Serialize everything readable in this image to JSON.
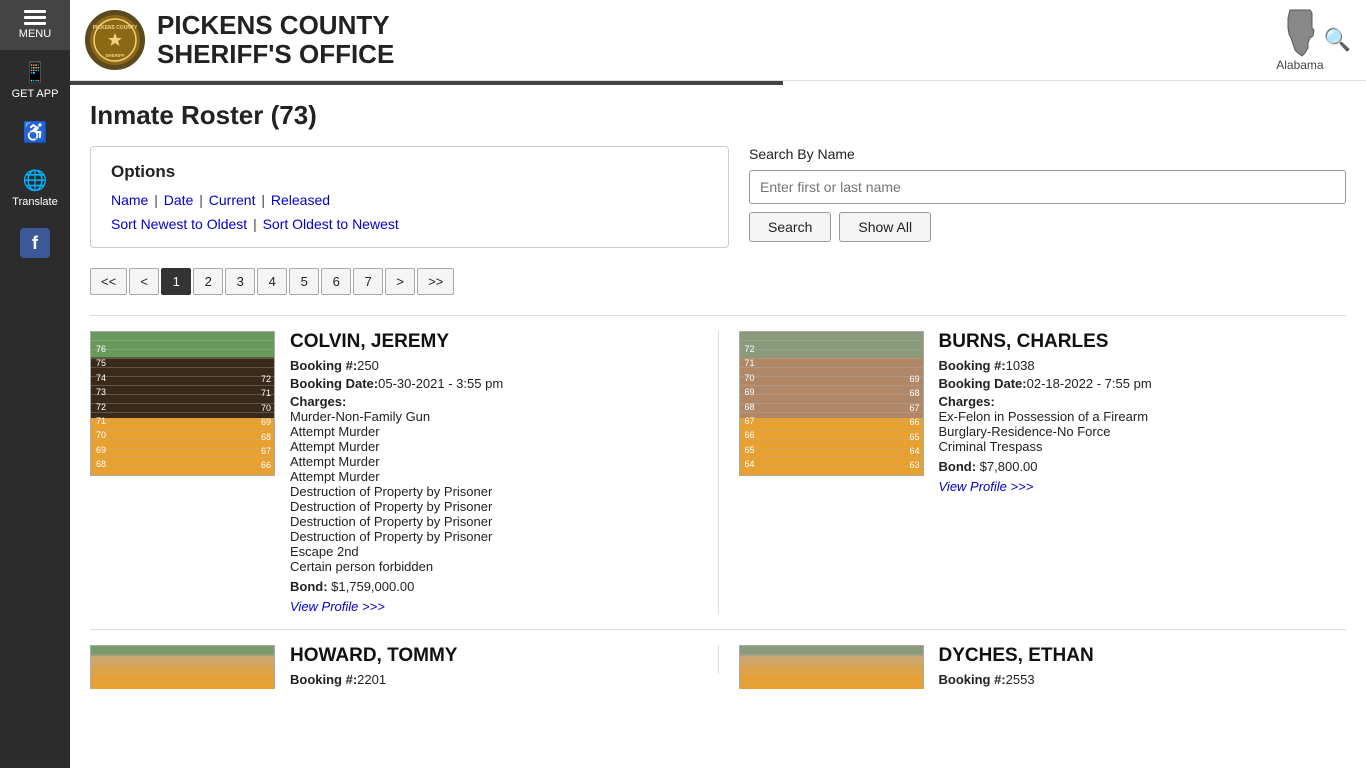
{
  "sidebar": {
    "items": [
      {
        "id": "menu",
        "label": "MENU",
        "icon": "≡"
      },
      {
        "id": "get-app",
        "label": "GET APP",
        "icon": "📱"
      },
      {
        "id": "accessibility",
        "label": "",
        "icon": "♿"
      },
      {
        "id": "translate",
        "label": "Translate",
        "icon": "🌐"
      },
      {
        "id": "facebook",
        "label": "",
        "icon": "f"
      }
    ]
  },
  "header": {
    "agency": "PICKENS COUNTY",
    "office": "SHERIFF'S OFFICE",
    "state": "Alabama"
  },
  "page": {
    "title": "Inmate Roster (73)"
  },
  "options": {
    "title": "Options",
    "links": {
      "name": "Name",
      "date": "Date",
      "current": "Current",
      "released": "Released"
    },
    "sort": {
      "newest": "Sort Newest to Oldest",
      "oldest": "Sort Oldest to Newest"
    }
  },
  "search": {
    "label": "Search By Name",
    "placeholder": "Enter first or last name",
    "search_btn": "Search",
    "show_all_btn": "Show All"
  },
  "pagination": {
    "first": "<<",
    "prev": "<",
    "pages": [
      "1",
      "2",
      "3",
      "4",
      "5",
      "6",
      "7"
    ],
    "next": ">",
    "last": ">>",
    "active": "1"
  },
  "inmates": [
    {
      "name": "COLVIN, JEREMY",
      "booking_num": "250",
      "booking_date": "05-30-2021 - 3:55 pm",
      "charges": [
        "Murder-Non-Family Gun",
        "Attempt Murder",
        "Attempt Murder",
        "Attempt Murder",
        "Attempt Murder",
        "Destruction of Property by Prisoner",
        "Destruction of Property by Prisoner",
        "Destruction of Property by Prisoner",
        "Destruction of Property by Prisoner",
        "Escape 2nd",
        "Certain person forbidden"
      ],
      "bond": "$1,759,000.00",
      "profile_link": "View Profile >>>"
    },
    {
      "name": "BURNS, CHARLES",
      "booking_num": "1038",
      "booking_date": "02-18-2022 - 7:55 pm",
      "charges": [
        "Ex-Felon in Possession of a Firearm",
        "Burglary-Residence-No Force",
        "Criminal Trespass"
      ],
      "bond": "$7,800.00",
      "profile_link": "View Profile >>>"
    },
    {
      "name": "HOWARD, TOMMY",
      "booking_num": "2201",
      "booking_date": "",
      "charges": [],
      "bond": "",
      "profile_link": ""
    },
    {
      "name": "DYCHES, ETHAN",
      "booking_num": "2553",
      "booking_date": "",
      "charges": [],
      "bond": "",
      "profile_link": ""
    }
  ],
  "labels": {
    "booking_num": "Booking #:",
    "booking_date": "Booking Date:",
    "charges": "Charges:",
    "bond": "Bond:"
  }
}
